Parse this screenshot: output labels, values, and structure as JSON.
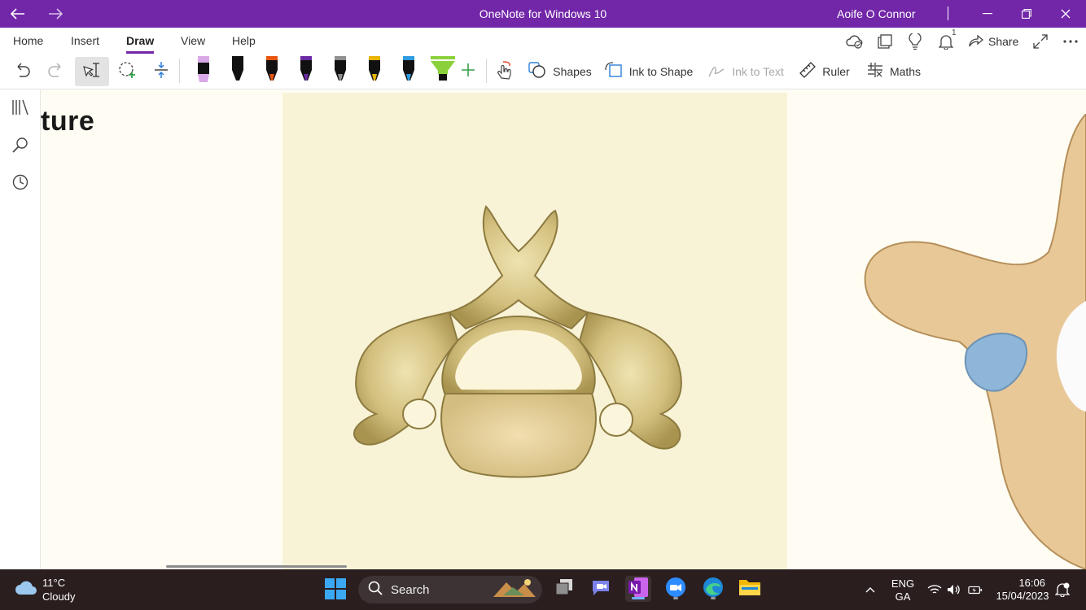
{
  "window": {
    "title": "OneNote for Windows 10",
    "user": "Aoife O Connor",
    "icons": [
      "back-arrow-icon",
      "forward-arrow-icon",
      "minimize-icon",
      "restore-icon",
      "close-icon"
    ],
    "accent": "#7226a8"
  },
  "menu": {
    "tabs": [
      "Home",
      "Insert",
      "Draw",
      "View",
      "Help"
    ],
    "active_tab": "Draw",
    "notification_count": "1",
    "share_label": "Share",
    "icons": [
      "sync-status-icon",
      "sticky-notes-icon",
      "lightbulb-icon",
      "bell-icon",
      "share-icon",
      "expand-icon",
      "more-icon"
    ]
  },
  "ribbon": {
    "shapes_label": "Shapes",
    "ink_to_shape_label": "Ink to Shape",
    "ink_to_text_label": "Ink to Text",
    "ruler_label": "Ruler",
    "maths_label": "Maths",
    "pens": [
      {
        "kind": "highlighter",
        "color": "#d9a8e6"
      },
      {
        "kind": "pen",
        "color": "#111111"
      },
      {
        "kind": "pen",
        "color": "#e8550f"
      },
      {
        "kind": "pen",
        "color": "#6b2aa3"
      },
      {
        "kind": "pen",
        "color": "#909090"
      },
      {
        "kind": "pen",
        "color": "#e8b400"
      },
      {
        "kind": "pen",
        "color": "#2e9be0"
      },
      {
        "kind": "highlighter",
        "color": "#8bd13c"
      }
    ]
  },
  "leftrail": {
    "icons": [
      "notebooks-icon",
      "search-icon",
      "recent-icon"
    ]
  },
  "page": {
    "heading": "ture"
  },
  "taskbar": {
    "weather_temp": "11°C",
    "weather_desc": "Cloudy",
    "search_label": "Search",
    "language_line1": "ENG",
    "language_line2": "GA",
    "time": "16:06",
    "date": "15/04/2023"
  }
}
